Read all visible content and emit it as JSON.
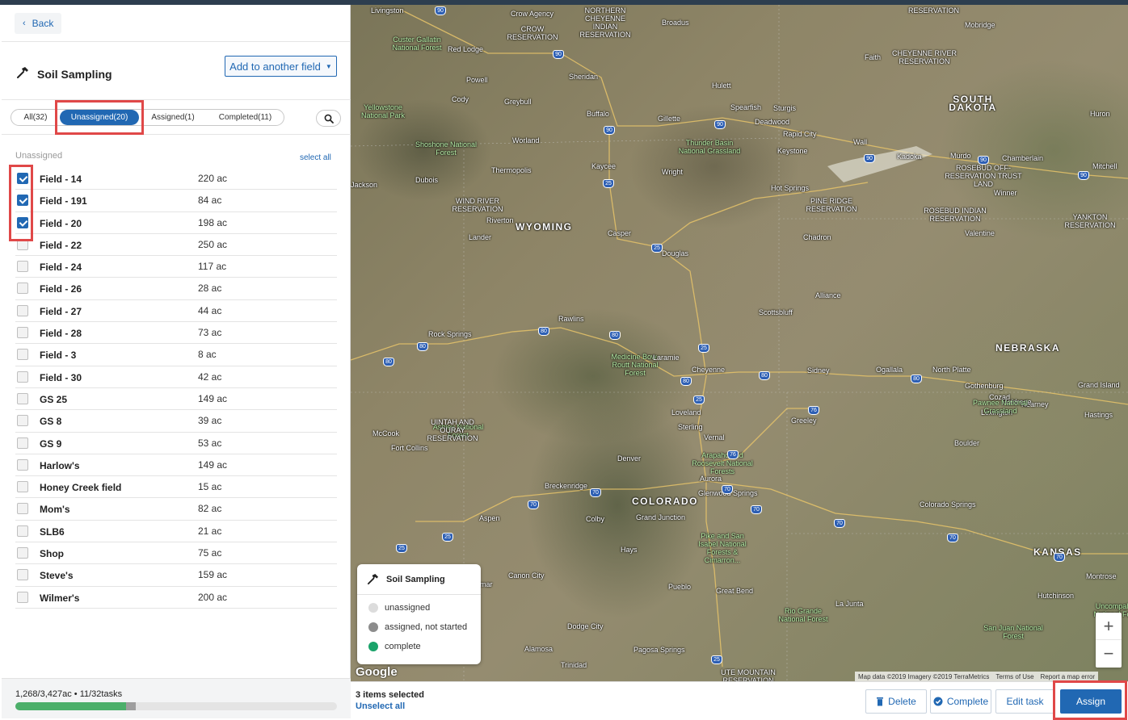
{
  "header": {
    "back_label": "Back"
  },
  "task": {
    "title": "Soil Sampling",
    "add_field_label": "Add to another field"
  },
  "tabs": [
    {
      "label": "All(32)"
    },
    {
      "label": "Unassigned(20)"
    },
    {
      "label": "Assigned(1)"
    },
    {
      "label": "Completed(11)"
    }
  ],
  "list": {
    "section_title": "Unassigned",
    "select_all_label": "select all",
    "fields": [
      {
        "name": "Field - 14",
        "acres": "220 ac",
        "checked": true
      },
      {
        "name": "Field - 191",
        "acres": "84 ac",
        "checked": true
      },
      {
        "name": "Field - 20",
        "acres": "198 ac",
        "checked": true
      },
      {
        "name": "Field - 22",
        "acres": "250 ac",
        "checked": false
      },
      {
        "name": "Field - 24",
        "acres": "117 ac",
        "checked": false
      },
      {
        "name": "Field - 26",
        "acres": "28 ac",
        "checked": false
      },
      {
        "name": "Field - 27",
        "acres": "44 ac",
        "checked": false
      },
      {
        "name": "Field - 28",
        "acres": "73 ac",
        "checked": false
      },
      {
        "name": "Field - 3",
        "acres": "8 ac",
        "checked": false
      },
      {
        "name": "Field - 30",
        "acres": "42 ac",
        "checked": false
      },
      {
        "name": "GS 25",
        "acres": "149 ac",
        "checked": false
      },
      {
        "name": "GS 8",
        "acres": "39 ac",
        "checked": false
      },
      {
        "name": "GS 9",
        "acres": "53 ac",
        "checked": false
      },
      {
        "name": "Harlow's",
        "acres": "149 ac",
        "checked": false
      },
      {
        "name": "Honey Creek field",
        "acres": "15 ac",
        "checked": false
      },
      {
        "name": "Mom's",
        "acres": "82 ac",
        "checked": false
      },
      {
        "name": "SLB6",
        "acres": "21 ac",
        "checked": false
      },
      {
        "name": "Shop",
        "acres": "75 ac",
        "checked": false
      },
      {
        "name": "Steve's",
        "acres": "159 ac",
        "checked": false
      },
      {
        "name": "Wilmer's",
        "acres": "200 ac",
        "checked": false
      }
    ]
  },
  "footer": {
    "summary": "1,268/3,427ac • 11/32tasks",
    "progress_complete": 0.344,
    "progress_started": 0.031
  },
  "legend": {
    "title": "Soil Sampling",
    "items": [
      {
        "label": "unassigned",
        "color": "#dcdcdc"
      },
      {
        "label": "assigned, not started",
        "color": "#8c8c8c"
      },
      {
        "label": "complete",
        "color": "#1aa36a"
      }
    ]
  },
  "map": {
    "labels": [
      {
        "text": "Livingston",
        "kind": "city"
      },
      {
        "text": "Crow Agency",
        "kind": "city"
      },
      {
        "text": "NORTHERN CHEYENNE INDIAN RESERVATION",
        "kind": "res"
      },
      {
        "text": "CROW RESERVATION",
        "kind": "res"
      },
      {
        "text": "Broadus",
        "kind": "city"
      },
      {
        "text": "RESERVATION",
        "kind": "res"
      },
      {
        "text": "Mobridge",
        "kind": "city"
      },
      {
        "text": "Custer Gallatin National Forest",
        "kind": "nat"
      },
      {
        "text": "Red Lodge",
        "kind": "city"
      },
      {
        "text": "Faith",
        "kind": "city"
      },
      {
        "text": "CHEYENNE RIVER RESERVATION",
        "kind": "res"
      },
      {
        "text": "Sheridan",
        "kind": "city"
      },
      {
        "text": "Powell",
        "kind": "city"
      },
      {
        "text": "Hulett",
        "kind": "city"
      },
      {
        "text": "SOUTH DAKOTA",
        "kind": "state"
      },
      {
        "text": "Cody",
        "kind": "city"
      },
      {
        "text": "Yellowstone National Park",
        "kind": "nat"
      },
      {
        "text": "Greybull",
        "kind": "city"
      },
      {
        "text": "Buffalo",
        "kind": "city"
      },
      {
        "text": "Gillette",
        "kind": "city"
      },
      {
        "text": "Spearfish",
        "kind": "city"
      },
      {
        "text": "Sturgis",
        "kind": "city"
      },
      {
        "text": "Deadwood",
        "kind": "city"
      },
      {
        "text": "Huron",
        "kind": "city"
      },
      {
        "text": "Rapid City",
        "kind": "city"
      },
      {
        "text": "Wall",
        "kind": "city"
      },
      {
        "text": "Shoshone National Forest",
        "kind": "nat"
      },
      {
        "text": "Worland",
        "kind": "city"
      },
      {
        "text": "Thunder Basin National Grassland",
        "kind": "nat"
      },
      {
        "text": "Keystone",
        "kind": "city"
      },
      {
        "text": "Kadoka",
        "kind": "city"
      },
      {
        "text": "Murdo",
        "kind": "city"
      },
      {
        "text": "Chamberlain",
        "kind": "city"
      },
      {
        "text": "Mitchell",
        "kind": "city"
      },
      {
        "text": "Thermopolis",
        "kind": "city"
      },
      {
        "text": "ROSEBUD OFF-RESERVATION TRUST LAND",
        "kind": "res"
      },
      {
        "text": "Kaycee",
        "kind": "city"
      },
      {
        "text": "Dubois",
        "kind": "city"
      },
      {
        "text": "Wright",
        "kind": "city"
      },
      {
        "text": "Jackson",
        "kind": "city"
      },
      {
        "text": "Hot Springs",
        "kind": "city"
      },
      {
        "text": "Winner",
        "kind": "city"
      },
      {
        "text": "WIND RIVER RESERVATION",
        "kind": "res"
      },
      {
        "text": "PINE RIDGE RESERVATION",
        "kind": "res"
      },
      {
        "text": "ROSEBUD INDIAN RESERVATION",
        "kind": "res"
      },
      {
        "text": "Riverton",
        "kind": "city"
      },
      {
        "text": "YANKTON RESERVATION",
        "kind": "res"
      },
      {
        "text": "WYOMING",
        "kind": "state"
      },
      {
        "text": "Lander",
        "kind": "city"
      },
      {
        "text": "Casper",
        "kind": "city"
      },
      {
        "text": "Chadron",
        "kind": "city"
      },
      {
        "text": "Valentine",
        "kind": "city"
      },
      {
        "text": "Douglas",
        "kind": "city"
      },
      {
        "text": "Alliance",
        "kind": "city"
      },
      {
        "text": "Scottsbluff",
        "kind": "city"
      },
      {
        "text": "Rawlins",
        "kind": "city"
      },
      {
        "text": "Rock Springs",
        "kind": "city"
      },
      {
        "text": "NEBRASKA",
        "kind": "state"
      },
      {
        "text": "Medicine Bow-Routt National Forest",
        "kind": "nat"
      },
      {
        "text": "Laramie",
        "kind": "city"
      },
      {
        "text": "Cheyenne",
        "kind": "city"
      },
      {
        "text": "Sidney",
        "kind": "city"
      },
      {
        "text": "Ogallala",
        "kind": "city"
      },
      {
        "text": "North Platte",
        "kind": "city"
      },
      {
        "text": "Gothenburg",
        "kind": "city"
      },
      {
        "text": "Grand Island",
        "kind": "city"
      },
      {
        "text": "Cozad",
        "kind": "city"
      },
      {
        "text": "Kearney",
        "kind": "city"
      },
      {
        "text": "Lexington",
        "kind": "city"
      },
      {
        "text": "Hastings",
        "kind": "city"
      },
      {
        "text": "Holdrege",
        "kind": "city"
      },
      {
        "text": "Pawnee National Grassland",
        "kind": "nat"
      },
      {
        "text": "Ashley National Forest",
        "kind": "nat"
      },
      {
        "text": "Fort Collins",
        "kind": "city"
      },
      {
        "text": "Loveland",
        "kind": "city"
      },
      {
        "text": "Sterling",
        "kind": "city"
      },
      {
        "text": "Greeley",
        "kind": "city"
      },
      {
        "text": "Vernal",
        "kind": "city"
      },
      {
        "text": "UINTAH AND OURAY RESERVATION",
        "kind": "res"
      },
      {
        "text": "McCook",
        "kind": "city"
      },
      {
        "text": "Boulder",
        "kind": "city"
      },
      {
        "text": "Arapaho and Roosevelt National Forests",
        "kind": "nat"
      },
      {
        "text": "Denver",
        "kind": "city"
      },
      {
        "text": "Aurora",
        "kind": "city"
      },
      {
        "text": "Glenwood Springs",
        "kind": "city"
      },
      {
        "text": "Breckenridge",
        "kind": "city"
      },
      {
        "text": "COLORADO",
        "kind": "state"
      },
      {
        "text": "Grand Junction",
        "kind": "city"
      },
      {
        "text": "Aspen",
        "kind": "city"
      },
      {
        "text": "Colby",
        "kind": "city"
      },
      {
        "text": "Colorado Springs",
        "kind": "city"
      },
      {
        "text": "Pike and San Isabel National Forests & Cimarron...",
        "kind": "nat"
      },
      {
        "text": "Hays",
        "kind": "city"
      },
      {
        "text": "KANSAS",
        "kind": "state"
      },
      {
        "text": "Montrose",
        "kind": "city"
      },
      {
        "text": "Canon City",
        "kind": "city"
      },
      {
        "text": "Pueblo",
        "kind": "city"
      },
      {
        "text": "Great Bend",
        "kind": "city"
      },
      {
        "text": "Hutchinson",
        "kind": "city"
      },
      {
        "text": "Uncompahgre National Forest",
        "kind": "nat"
      },
      {
        "text": "Lamar",
        "kind": "city"
      },
      {
        "text": "La Junta",
        "kind": "city"
      },
      {
        "text": "Rio Grande National Forest",
        "kind": "nat"
      },
      {
        "text": "Dodge City",
        "kind": "city"
      },
      {
        "text": "San Juan National Forest",
        "kind": "nat"
      },
      {
        "text": "Alamosa",
        "kind": "city"
      },
      {
        "text": "Pagosa Springs",
        "kind": "city"
      },
      {
        "text": "Trinidad",
        "kind": "city"
      },
      {
        "text": "UTE MOUNTAIN RESERVATION",
        "kind": "res"
      }
    ],
    "highways": [
      "90",
      "90",
      "90",
      "90",
      "90",
      "90",
      "90",
      "25",
      "25",
      "25",
      "80",
      "80",
      "80",
      "80",
      "80",
      "80",
      "80",
      "25",
      "76",
      "76",
      "70",
      "70",
      "70",
      "70",
      "70",
      "70",
      "70",
      "25",
      "25",
      "25"
    ],
    "google_logo": "Google",
    "attribution": [
      "Map data ©2019 Imagery ©2019 TerraMetrics",
      "Terms of Use",
      "Report a map error"
    ],
    "zoom_in": "+",
    "zoom_out": "−"
  },
  "actionbar": {
    "selected_text": "3 items selected",
    "unselect_label": "Unselect all",
    "delete_label": "Delete",
    "complete_label": "Complete",
    "edit_label": "Edit task",
    "assign_label": "Assign"
  }
}
